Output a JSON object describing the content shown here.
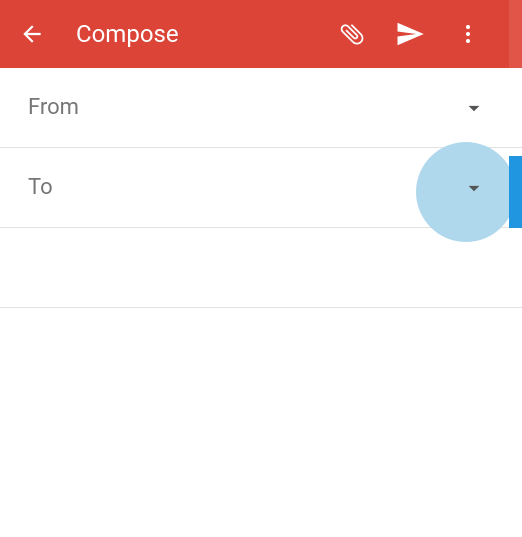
{
  "toolbar": {
    "title": "Compose",
    "back_icon": "back",
    "attach_icon": "attachment",
    "send_icon": "send",
    "menu_icon": "more"
  },
  "fields": {
    "from_label": "From",
    "to_label": "To"
  },
  "colors": {
    "primary": "#db4437",
    "highlight": "#b0d8ec",
    "accent": "#2196e0"
  }
}
